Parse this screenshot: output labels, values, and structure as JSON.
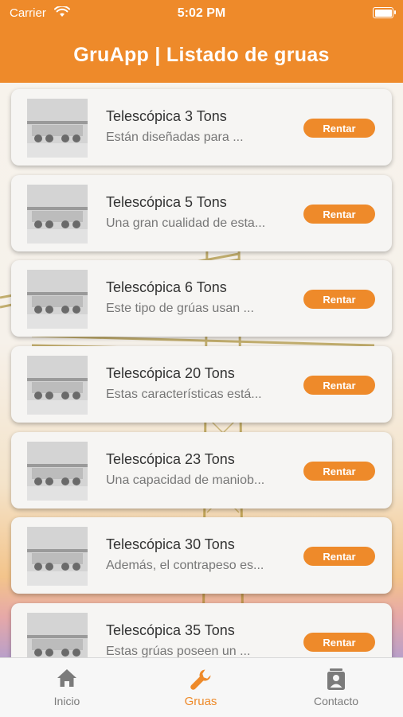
{
  "status_bar": {
    "carrier": "Carrier",
    "time": "5:02 PM"
  },
  "header": {
    "title": "GruApp | Listado de gruas"
  },
  "cranes": [
    {
      "title": "Telescópica 3 Tons",
      "description": "Están diseñadas para ...",
      "button": "Rentar"
    },
    {
      "title": "Telescópica 5 Tons",
      "description": "Una gran cualidad de esta...",
      "button": "Rentar"
    },
    {
      "title": "Telescópica 6 Tons",
      "description": "Este tipo de grúas usan ...",
      "button": "Rentar"
    },
    {
      "title": "Telescópica 20 Tons",
      "description": "Estas características está...",
      "button": "Rentar"
    },
    {
      "title": "Telescópica 23 Tons",
      "description": "Una capacidad de maniob...",
      "button": "Rentar"
    },
    {
      "title": "Telescópica 30 Tons",
      "description": "Además, el contrapeso es...",
      "button": "Rentar"
    },
    {
      "title": "Telescópica 35 Tons",
      "description": "Estas grúas poseen un ...",
      "button": "Rentar"
    }
  ],
  "tabs": [
    {
      "label": "Inicio",
      "icon": "home-icon",
      "active": false
    },
    {
      "label": "Gruas",
      "icon": "wrench-icon",
      "active": true
    },
    {
      "label": "Contacto",
      "icon": "contact-icon",
      "active": false
    }
  ],
  "colors": {
    "accent": "#ee8a2a",
    "card": "#f6f5f3",
    "inactive": "#7b7b7b"
  }
}
